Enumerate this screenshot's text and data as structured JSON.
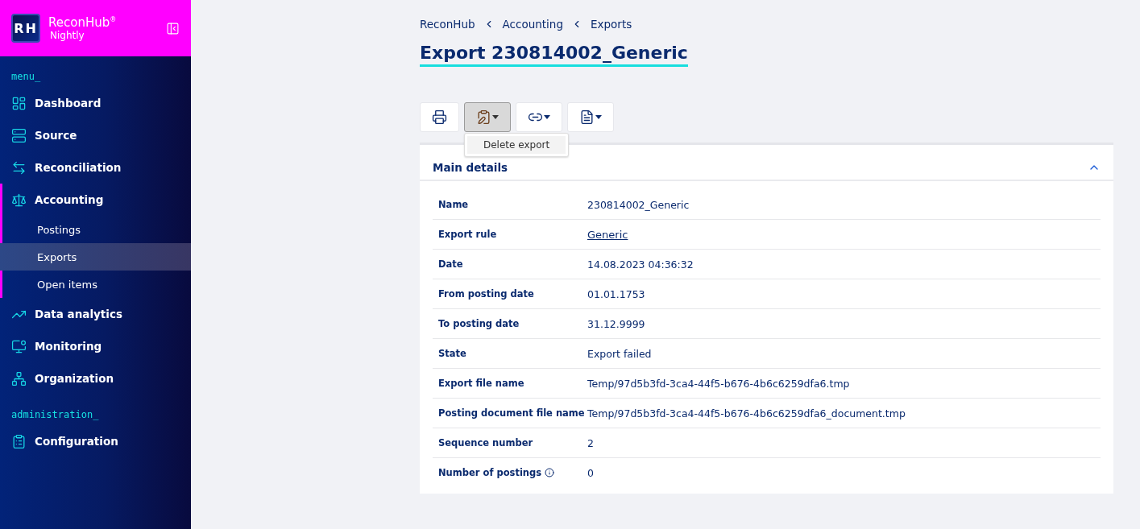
{
  "brand": {
    "logo": "RH",
    "name": "ReconHub",
    "mark": "®",
    "edition": "Nightly"
  },
  "sidebar": {
    "sections": [
      {
        "heading": "menu_",
        "items": [
          {
            "label": "Dashboard",
            "selected": false
          },
          {
            "label": "Source",
            "selected": false
          },
          {
            "label": "Reconciliation",
            "selected": false
          },
          {
            "label": "Accounting",
            "expanded": true,
            "selected": false,
            "children": [
              {
                "label": "Postings",
                "selected": false
              },
              {
                "label": "Exports",
                "selected": true
              },
              {
                "label": "Open items",
                "selected": false
              }
            ]
          },
          {
            "label": "Data analytics",
            "selected": false
          },
          {
            "label": "Monitoring",
            "selected": false
          },
          {
            "label": "Organization",
            "selected": false
          }
        ]
      },
      {
        "heading": "administration_",
        "items": [
          {
            "label": "Configuration",
            "selected": false
          }
        ]
      }
    ]
  },
  "breadcrumb": [
    "ReconHub",
    "Accounting",
    "Exports"
  ],
  "title": "Export 230814002_Generic",
  "toolbar": [
    {
      "kind": "print",
      "expanded": false
    },
    {
      "kind": "tools",
      "expanded": true,
      "menu": [
        "Delete export"
      ]
    },
    {
      "kind": "link",
      "expanded": false
    },
    {
      "kind": "document",
      "expanded": false
    }
  ],
  "panel": {
    "title": "Main details",
    "expanded": true,
    "rows": [
      {
        "label": "Name",
        "value": "230814002_Generic",
        "kind": "text"
      },
      {
        "label": "Export rule",
        "value": "Generic",
        "kind": "link"
      },
      {
        "label": "Date",
        "value": "14.08.2023 04:36:32",
        "kind": "text"
      },
      {
        "label": "From posting date",
        "value": "01.01.1753",
        "kind": "text"
      },
      {
        "label": "To posting date",
        "value": "31.12.9999",
        "kind": "text"
      },
      {
        "label": "State",
        "value": "Export failed",
        "kind": "text"
      },
      {
        "label": "Export file name",
        "value": "Temp/97d5b3fd-3ca4-44f5-b676-4b6c6259dfa6.tmp",
        "kind": "text"
      },
      {
        "label": "Posting document file name",
        "value": "Temp/97d5b3fd-3ca4-44f5-b676-4b6c6259dfa6_document.tmp",
        "kind": "text"
      },
      {
        "label": "Sequence number",
        "value": "2",
        "kind": "text"
      },
      {
        "label": "Number of postings",
        "value": "0",
        "kind": "text",
        "info": true
      }
    ]
  }
}
